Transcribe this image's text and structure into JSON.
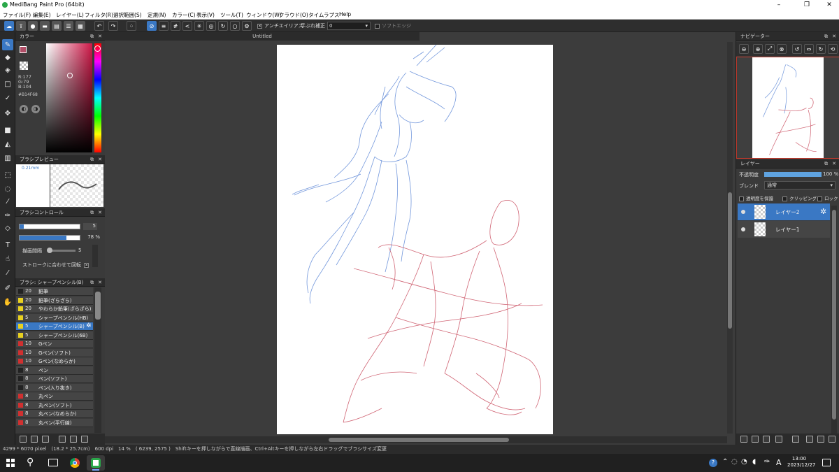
{
  "window": {
    "title": "MediBang Paint Pro (64bit)",
    "minimize": "–",
    "maximize": "❐",
    "close": "✕"
  },
  "menu": [
    "ファイル(F)",
    "編集(E)",
    "レイヤー(L)",
    "フィルタ(R)",
    "選択範囲(S)",
    "定規(N)",
    "カラー(C)",
    "表示(V)",
    "ツール(T)",
    "ウィンドウ(W)",
    "クラウド(O)",
    "タイムラプス",
    "Help"
  ],
  "toolbar": {
    "antialias_label": "アンチエイリアス",
    "stabilizer_label": "手ぶれ補正",
    "stabilizer_value": "0",
    "soft_edge_label": "ソフトエッジ"
  },
  "canvas": {
    "tab_title": "Untitled"
  },
  "color_panel": {
    "title": "カラー",
    "r": "R:177",
    "g": "G:79",
    "b": "B:104",
    "hex": "#B14F68",
    "primary": "#b14f68"
  },
  "brush_preview": {
    "title": "ブラシプレビュー",
    "size": "0.21mm"
  },
  "brush_control": {
    "title": "ブラシコントロール",
    "size_value": "5",
    "opacity_value": "78 %",
    "opacity": 0.78,
    "spacing_label": "描画間隔",
    "spacing_value": "5",
    "rotate_label": "ストロークに合わせて回転"
  },
  "brush_list": {
    "title": "ブラシ: シャープペンシル(B)",
    "items": [
      {
        "size": "20",
        "name": "鉛筆",
        "color": "#222222"
      },
      {
        "size": "20",
        "name": "鉛筆(ざらざら)",
        "color": "#e8d020"
      },
      {
        "size": "20",
        "name": "やわらか鉛筆(ざらざら)",
        "color": "#e8d020"
      },
      {
        "size": "5",
        "name": "シャープペンシル(HB)",
        "color": "#e8d020"
      },
      {
        "size": "5",
        "name": "シャープペンシル(B)",
        "color": "#e8d020"
      },
      {
        "size": "5",
        "name": "シャープペンシル(6B)",
        "color": "#e8d020"
      },
      {
        "size": "10",
        "name": "Gペン",
        "color": "#d03030"
      },
      {
        "size": "10",
        "name": "Gペン(ソフト)",
        "color": "#d03030"
      },
      {
        "size": "10",
        "name": "Gペン(なめらか)",
        "color": "#d03030"
      },
      {
        "size": "8",
        "name": "ペン",
        "color": "#222222"
      },
      {
        "size": "8",
        "name": "ペン(ソフト)",
        "color": "#222222"
      },
      {
        "size": "8",
        "name": "ペン(入り抜き)",
        "color": "#222222"
      },
      {
        "size": "8",
        "name": "丸ペン",
        "color": "#d03030"
      },
      {
        "size": "8",
        "name": "丸ペン(ソフト)",
        "color": "#d03030"
      },
      {
        "size": "8",
        "name": "丸ペン(なめらか)",
        "color": "#d03030"
      },
      {
        "size": "8",
        "name": "丸ペン(平行線)",
        "color": "#d03030"
      }
    ],
    "selected_index": 4
  },
  "navigator": {
    "title": "ナビゲーター"
  },
  "layers": {
    "title": "レイヤー",
    "opacity_label": "不透明度",
    "opacity_value": "100 %",
    "blend_label": "ブレンド",
    "blend_value": "通常",
    "protect_label": "透明度を保護",
    "clip_label": "クリッピング",
    "lock_label": "ロック",
    "items": [
      {
        "name": "レイヤー2",
        "selected": true
      },
      {
        "name": "レイヤー1",
        "selected": false
      }
    ]
  },
  "status": {
    "text": "4299 * 6070 pixel　(18.2 * 25.7cm)　600 dpi　14 %　( 6239, 2575 )　Shiftキーを押しながらで直線描画、Ctrl+Altキーを押しながら左右ドラッグでブラシサイズ変更"
  },
  "taskbar": {
    "time": "13:00",
    "date": "2023/12/27",
    "ime": "A"
  }
}
